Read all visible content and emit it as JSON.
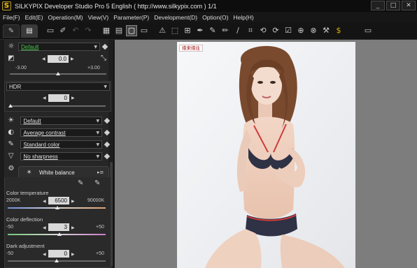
{
  "window": {
    "title": "SILKYPIX Developer Studio Pro 5 English ( http://www.silkypix.com )   1/1",
    "logo_glyph": "S",
    "minimize": "_",
    "maximize": "□",
    "close": "✕"
  },
  "menu": [
    "File(F)",
    "Edit(E)",
    "Operation(M)",
    "View(V)",
    "Parameter(P)",
    "Development(D)",
    "Option(O)",
    "Help(H)"
  ],
  "toolbar": {
    "tabs": [
      {
        "name": "tab-develop",
        "icon": "wrench-icon",
        "glyph": "✎"
      },
      {
        "name": "tab-folder",
        "icon": "folder-icon",
        "glyph": "▤"
      }
    ],
    "groups": [
      [
        {
          "name": "open-folder-button",
          "icon": "folder-open-icon",
          "glyph": "▭"
        },
        {
          "name": "brush-button",
          "icon": "brush-icon",
          "glyph": "✐"
        },
        {
          "name": "undo-button",
          "icon": "undo-icon",
          "glyph": "↶",
          "disabled": true
        },
        {
          "name": "redo-button",
          "icon": "redo-icon",
          "glyph": "↷",
          "disabled": true
        }
      ],
      [
        {
          "name": "view-thumbnail-button",
          "icon": "thumbnail-view-icon",
          "glyph": "▦"
        },
        {
          "name": "view-split-button",
          "icon": "split-view-icon",
          "glyph": "▤"
        },
        {
          "name": "view-single-button",
          "icon": "single-view-icon",
          "glyph": "▢",
          "selected": true
        },
        {
          "name": "view-fullscreen-button",
          "icon": "fullscreen-icon",
          "glyph": "▭"
        }
      ],
      [
        {
          "name": "warning-button",
          "icon": "warning-icon",
          "glyph": "⚠"
        },
        {
          "name": "fit-button",
          "icon": "fit-icon",
          "glyph": "⬚"
        },
        {
          "name": "grid-button",
          "icon": "grid-icon",
          "glyph": "⊞"
        },
        {
          "name": "eyedropper-button",
          "icon": "eyedropper-icon",
          "glyph": "✒"
        },
        {
          "name": "grayscale-picker-button",
          "icon": "gray-picker-icon",
          "glyph": "✎"
        },
        {
          "name": "skin-picker-button",
          "icon": "skin-picker-icon",
          "glyph": "✏"
        },
        {
          "name": "spot-button",
          "icon": "spot-icon",
          "glyph": "/"
        },
        {
          "name": "crop-button",
          "icon": "crop-icon",
          "glyph": "⌗"
        },
        {
          "name": "rotate-left-button",
          "icon": "rotate-left-icon",
          "glyph": "⟲"
        },
        {
          "name": "rotate-right-button",
          "icon": "rotate-right-icon",
          "glyph": "⟳"
        },
        {
          "name": "mark-button",
          "icon": "checkmark-icon",
          "glyph": "☑"
        },
        {
          "name": "parameter-copy-button",
          "icon": "copy-params-icon",
          "glyph": "⊕"
        },
        {
          "name": "parameter-paste-button",
          "icon": "paste-params-icon",
          "glyph": "⊗"
        },
        {
          "name": "develop-button",
          "icon": "hammer-icon",
          "glyph": "⚒"
        },
        {
          "name": "export-button",
          "icon": "coin-icon",
          "glyph": "$",
          "gold": true
        }
      ],
      [
        {
          "name": "monitor-button",
          "icon": "monitor-icon",
          "glyph": "▭"
        }
      ]
    ]
  },
  "panel": {
    "taste": {
      "icon": "sun-icon",
      "glyph": "☼",
      "value": "Default"
    },
    "exposure": {
      "icon": "exposure-icon",
      "glyph": "◩",
      "reset_icon": "reset-icon",
      "reset_glyph": "⤡",
      "value": "0.0",
      "min": "-3.00",
      "max": "+3.00",
      "level": 0.0,
      "range": [
        -3,
        3
      ]
    },
    "hdr": {
      "label": "HDR",
      "value": "0",
      "level": 0.0
    },
    "rows": [
      {
        "name": "white-balance-preset",
        "icon": "light-bulb-icon",
        "glyph": "☀",
        "value": "Default"
      },
      {
        "name": "tone-preset",
        "icon": "contrast-icon",
        "glyph": "◐",
        "value": "Average contrast"
      },
      {
        "name": "color-preset",
        "icon": "color-pen-icon",
        "glyph": "✎",
        "value": "Standard color"
      },
      {
        "name": "sharpness-preset",
        "icon": "sharpness-icon",
        "glyph": "▽",
        "value": "No sharpness"
      }
    ],
    "wb_section": {
      "icon": "settings-cluster-icon",
      "glyph": "⚙",
      "header_icon": "sun-icon",
      "header_glyph": "☀",
      "title": "White balance",
      "menu_glyph": "▸≡",
      "gray_picker_glyph": "✎",
      "skin_picker_glyph": "✎",
      "temperature": {
        "label": "Color temperature",
        "min": "2000K",
        "max": "90000K",
        "value": "6500",
        "level": 0.51
      },
      "deflection": {
        "label": "Color deflection",
        "min": "-50",
        "max": "+50",
        "value": "3",
        "level": 0.53
      },
      "dark": {
        "label": "Dark adjustment",
        "min": "-50",
        "max": "+50",
        "value": "0",
        "level": 0.5
      }
    }
  },
  "preview": {
    "watermark": "缘来缘往",
    "caption": "portrait photo"
  },
  "colors": {
    "accent_green": "#49c44a",
    "logo_gold": "#e3b000"
  }
}
